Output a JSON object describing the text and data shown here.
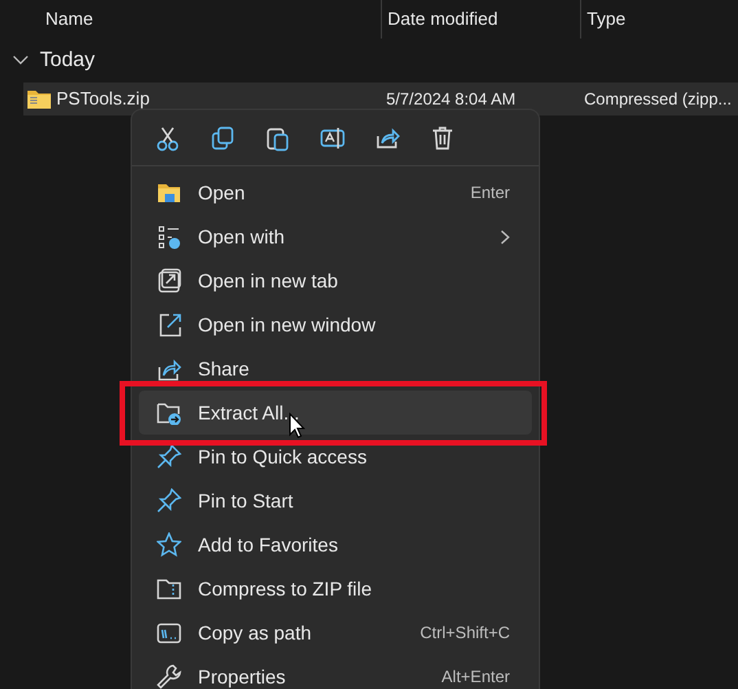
{
  "columns": [
    {
      "label": "Name"
    },
    {
      "label": "Date modified"
    },
    {
      "label": "Type"
    }
  ],
  "group": {
    "label": "Today",
    "expanded": true
  },
  "file": {
    "name": "PSTools.zip",
    "date": "5/7/2024 8:04 AM",
    "type": "Compressed (zipp...",
    "selected": true
  },
  "toolbar": [
    {
      "kind": "cut"
    },
    {
      "kind": "copy"
    },
    {
      "kind": "paste"
    },
    {
      "kind": "rename"
    },
    {
      "kind": "share"
    },
    {
      "kind": "delete"
    }
  ],
  "menu_items": [
    {
      "kind": "open",
      "label": "Open",
      "shortcut": "Enter",
      "selected": false
    },
    {
      "kind": "open-with",
      "label": "Open with",
      "submenu": true,
      "selected": false
    },
    {
      "kind": "new-tab",
      "label": "Open in new tab",
      "selected": false
    },
    {
      "kind": "new-window",
      "label": "Open in new window",
      "selected": false
    },
    {
      "kind": "share",
      "label": "Share",
      "selected": false
    },
    {
      "kind": "extract",
      "label": "Extract All...",
      "selected": true,
      "highlighted": true
    },
    {
      "kind": "pin",
      "label": "Pin to Quick access",
      "selected": false
    },
    {
      "kind": "pin",
      "label": "Pin to Start",
      "selected": false
    },
    {
      "kind": "star",
      "label": "Add to Favorites",
      "selected": false
    },
    {
      "kind": "compress",
      "label": "Compress to ZIP file",
      "selected": false
    },
    {
      "kind": "path",
      "label": "Copy as path",
      "shortcut": "Ctrl+Shift+C",
      "selected": false
    },
    {
      "kind": "wrench",
      "label": "Properties",
      "shortcut": "Alt+Enter",
      "selected": false
    }
  ]
}
